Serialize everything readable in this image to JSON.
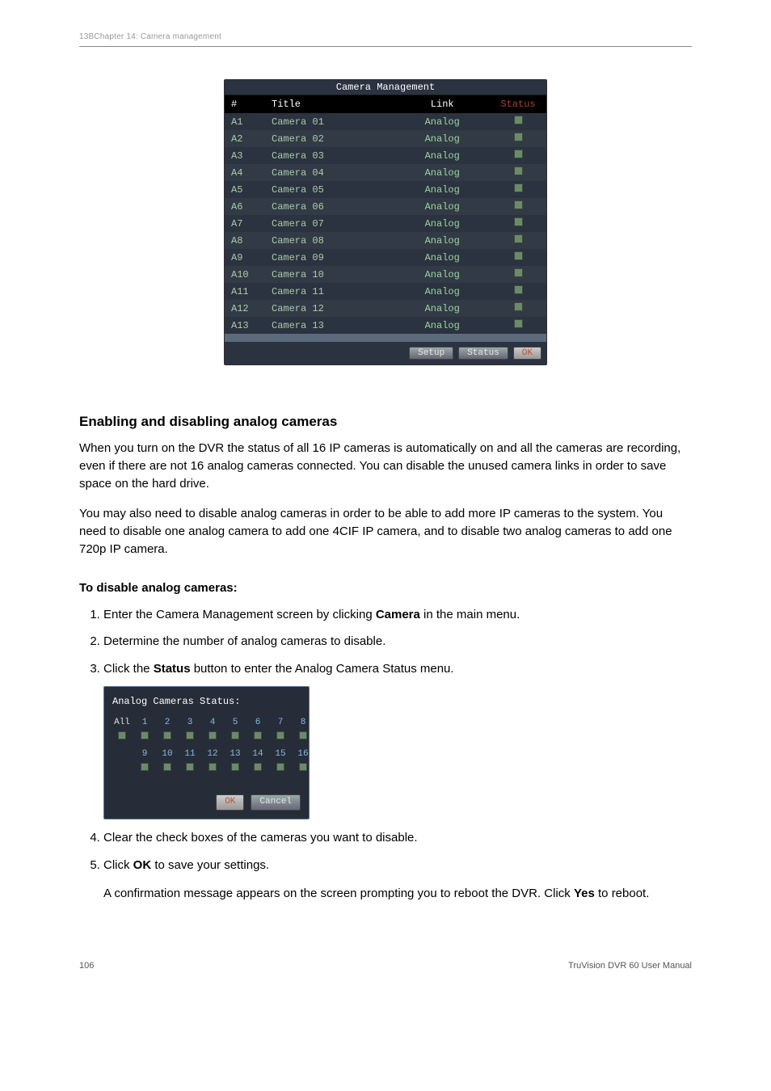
{
  "header": {
    "chapter_label": "13BChapter 14: Camera management"
  },
  "camera_management": {
    "title": "Camera  Management",
    "columns": [
      "#",
      "Title",
      "Link",
      "Status"
    ],
    "rows": [
      {
        "num": "A1",
        "title": "Camera 01",
        "link": "Analog"
      },
      {
        "num": "A2",
        "title": "Camera 02",
        "link": "Analog"
      },
      {
        "num": "A3",
        "title": "Camera 03",
        "link": "Analog"
      },
      {
        "num": "A4",
        "title": "Camera 04",
        "link": "Analog"
      },
      {
        "num": "A5",
        "title": "Camera 05",
        "link": "Analog"
      },
      {
        "num": "A6",
        "title": "Camera 06",
        "link": "Analog"
      },
      {
        "num": "A7",
        "title": "Camera 07",
        "link": "Analog"
      },
      {
        "num": "A8",
        "title": "Camera 08",
        "link": "Analog"
      },
      {
        "num": "A9",
        "title": "Camera 09",
        "link": "Analog"
      },
      {
        "num": "A10",
        "title": "Camera 10",
        "link": "Analog"
      },
      {
        "num": "A11",
        "title": "Camera 11",
        "link": "Analog"
      },
      {
        "num": "A12",
        "title": "Camera 12",
        "link": "Analog"
      },
      {
        "num": "A13",
        "title": "Camera 13",
        "link": "Analog"
      }
    ],
    "buttons": {
      "setup": "Setup",
      "status": "Status",
      "ok": "OK"
    }
  },
  "section": {
    "heading": "Enabling and disabling analog cameras",
    "p1": "When you turn on the DVR the status of all 16 IP cameras is automatically on and all the cameras are recording, even if there are not 16 analog cameras connected. You can disable the unused camera links in order to save space on the hard drive.",
    "p2": "You may also need to disable analog cameras in order to be able to add more IP cameras to the system. You need to disable one analog camera to add one 4CIF IP camera, and to disable two analog cameras to add one 720p IP camera.",
    "steps_label": "To disable analog cameras:",
    "steps": {
      "s1a": "Enter the Camera Management screen by clicking ",
      "s1b": " in the main menu.",
      "s1_bold": "Camera",
      "s2": "Determine the number of analog cameras to disable.",
      "s3a": "Click the ",
      "s3_bold": "Status",
      "s3b": " button to enter the Analog Camera Status menu.",
      "s4": "Clear the check boxes of the cameras you want to disable.",
      "s5a": "Click ",
      "s5_bold": "OK",
      "s5b": " to save your settings.",
      "s5c": "A confirmation message appears on the screen prompting you to reboot the DVR. Click ",
      "s5_bold2": "Yes",
      "s5d": " to reboot."
    }
  },
  "status_dialog": {
    "label": "Analog Cameras Status:",
    "row1_labels": [
      "All",
      "1",
      "2",
      "3",
      "4",
      "5",
      "6",
      "7",
      "8"
    ],
    "row2_labels": [
      "",
      "9",
      "10",
      "11",
      "12",
      "13",
      "14",
      "15",
      "16"
    ],
    "buttons": {
      "ok": "OK",
      "cancel": "Cancel"
    }
  },
  "footer": {
    "page": "106",
    "manual": "TruVision DVR 60 User Manual"
  }
}
